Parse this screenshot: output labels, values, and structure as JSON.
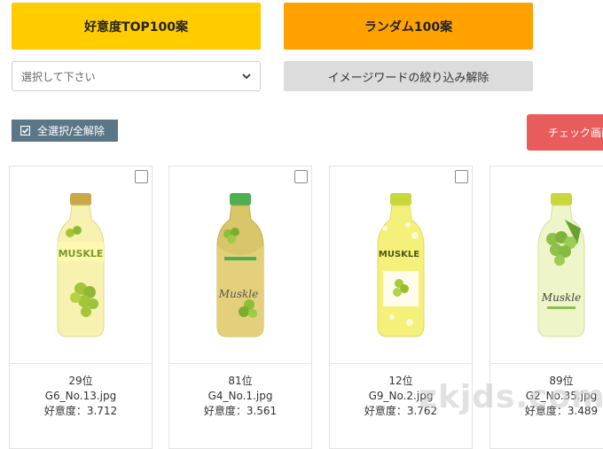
{
  "top_buttons": {
    "favorite_top": "好意度TOP100案",
    "random": "ランダム100案"
  },
  "filter": {
    "select_value": "選択して下さい",
    "clear_button": "イメージワードの絞り込み解除"
  },
  "actions": {
    "select_all": "全選択/全解除",
    "check_screen": "チェック画面を"
  },
  "cards": [
    {
      "rank": "29位",
      "filename": "G6_No.13.jpg",
      "score": "好意度：3.712",
      "checked": false
    },
    {
      "rank": "81位",
      "filename": "G4_No.1.jpg",
      "score": "好意度：3.561",
      "checked": false
    },
    {
      "rank": "12位",
      "filename": "G9_No.2.jpg",
      "score": "好意度：3.762",
      "checked": false
    },
    {
      "rank": "89位",
      "filename": "G2_No.35.jpg",
      "score": "好意度：3.489",
      "checked": false
    }
  ],
  "bottles": [
    {
      "cap": "#c9a84a",
      "label": "MUSKLE",
      "body": "#f7f2b0",
      "accent": "#a5c43a"
    },
    {
      "cap": "#4caf50",
      "label": "Muskle",
      "body": "#d9c56a",
      "accent": "#8bbf3a"
    },
    {
      "cap": "#c8d83a",
      "label": "MUSKLE",
      "body": "#f5f07a",
      "accent": "#a9c93a"
    },
    {
      "cap": "#c8d83a",
      "label": "Muskle",
      "body": "#eef5c8",
      "accent": "#8fc04a"
    }
  ],
  "watermark": "zkjds.com"
}
